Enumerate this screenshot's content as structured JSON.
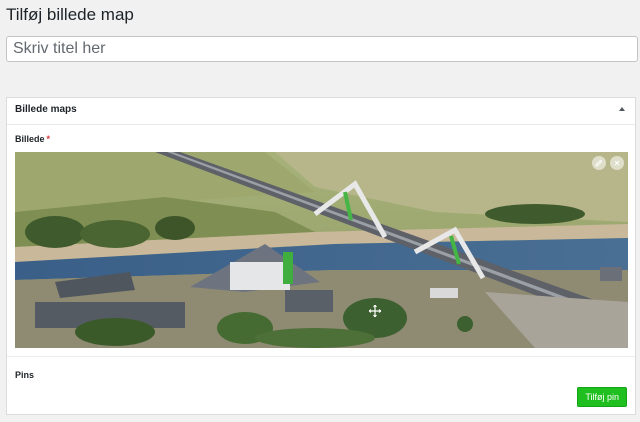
{
  "page": {
    "title": "Tilføj billede map"
  },
  "title_field": {
    "placeholder": "Skriv titel her"
  },
  "metabox": {
    "title": "Billede maps",
    "image_field": {
      "label": "Billede",
      "required_mark": "*"
    },
    "image_actions": {
      "edit_icon": "pencil-icon",
      "remove_icon": "close-icon"
    },
    "pins": {
      "label": "Pins",
      "add_button_label": "Tilføj pin"
    }
  },
  "colors": {
    "accent_green": "#1fbf1f",
    "required_red": "#d63638",
    "page_background": "#f1f1f1"
  }
}
